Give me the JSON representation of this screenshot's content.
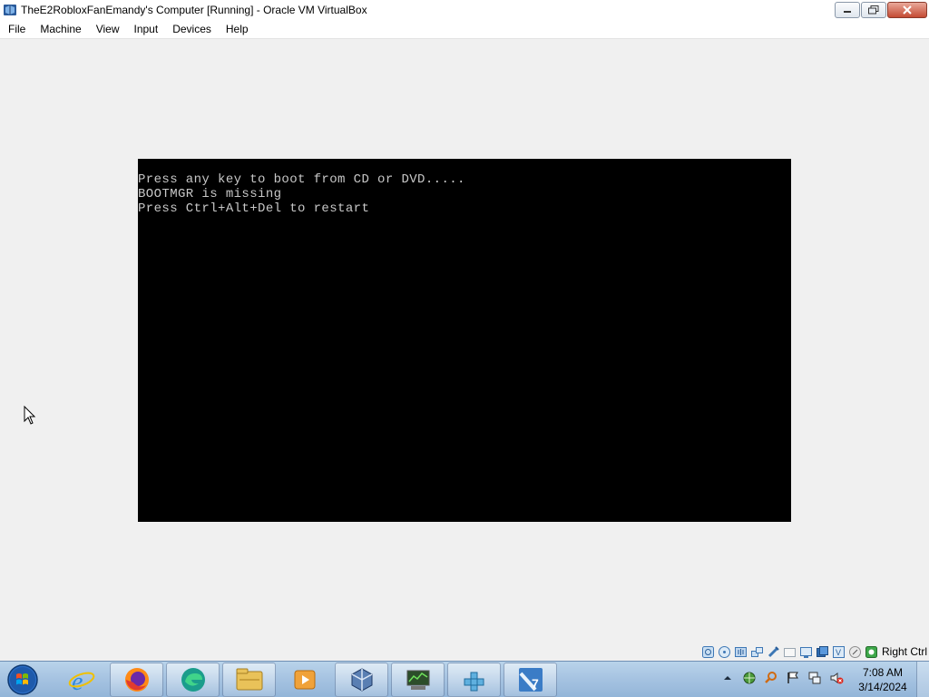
{
  "window": {
    "title": "TheE2RobloxFanEmandy's Computer [Running] - Oracle VM VirtualBox",
    "icon": "virtualbox-icon"
  },
  "menu": [
    {
      "label": "File"
    },
    {
      "label": "Machine"
    },
    {
      "label": "View"
    },
    {
      "label": "Input"
    },
    {
      "label": "Devices"
    },
    {
      "label": "Help"
    }
  ],
  "console": {
    "line1": "Press any key to boot from CD or DVD.....",
    "line2": "BOOTMGR is missing",
    "line3": "Press Ctrl+Alt+Del to restart"
  },
  "status_bar": {
    "icons": [
      "hard-disk-icon",
      "optical-drive-icon",
      "audio-icon",
      "network-icon",
      "usb-icon",
      "shared-folders-icon",
      "display-icon",
      "video-capture-icon",
      "mouse-integration-icon",
      "cpu-icon",
      "keyboard-capture-icon"
    ],
    "host_key": "Right Ctrl"
  },
  "taskbar": {
    "buttons": [
      "start-orb",
      "internet-explorer-icon",
      "firefox-icon",
      "edge-icon",
      "file-explorer-icon",
      "media-player-icon",
      "virtualbox-icon",
      "monitor-app-icon",
      "registry-icon",
      "windows7-app-icon"
    ],
    "tray_icons": [
      "show-hidden-icons-arrow",
      "network-globe-icon",
      "search-icon",
      "action-center-flag-icon",
      "network-icon",
      "volume-muted-icon"
    ],
    "time": "7:08 AM",
    "date": "3/14/2024"
  }
}
